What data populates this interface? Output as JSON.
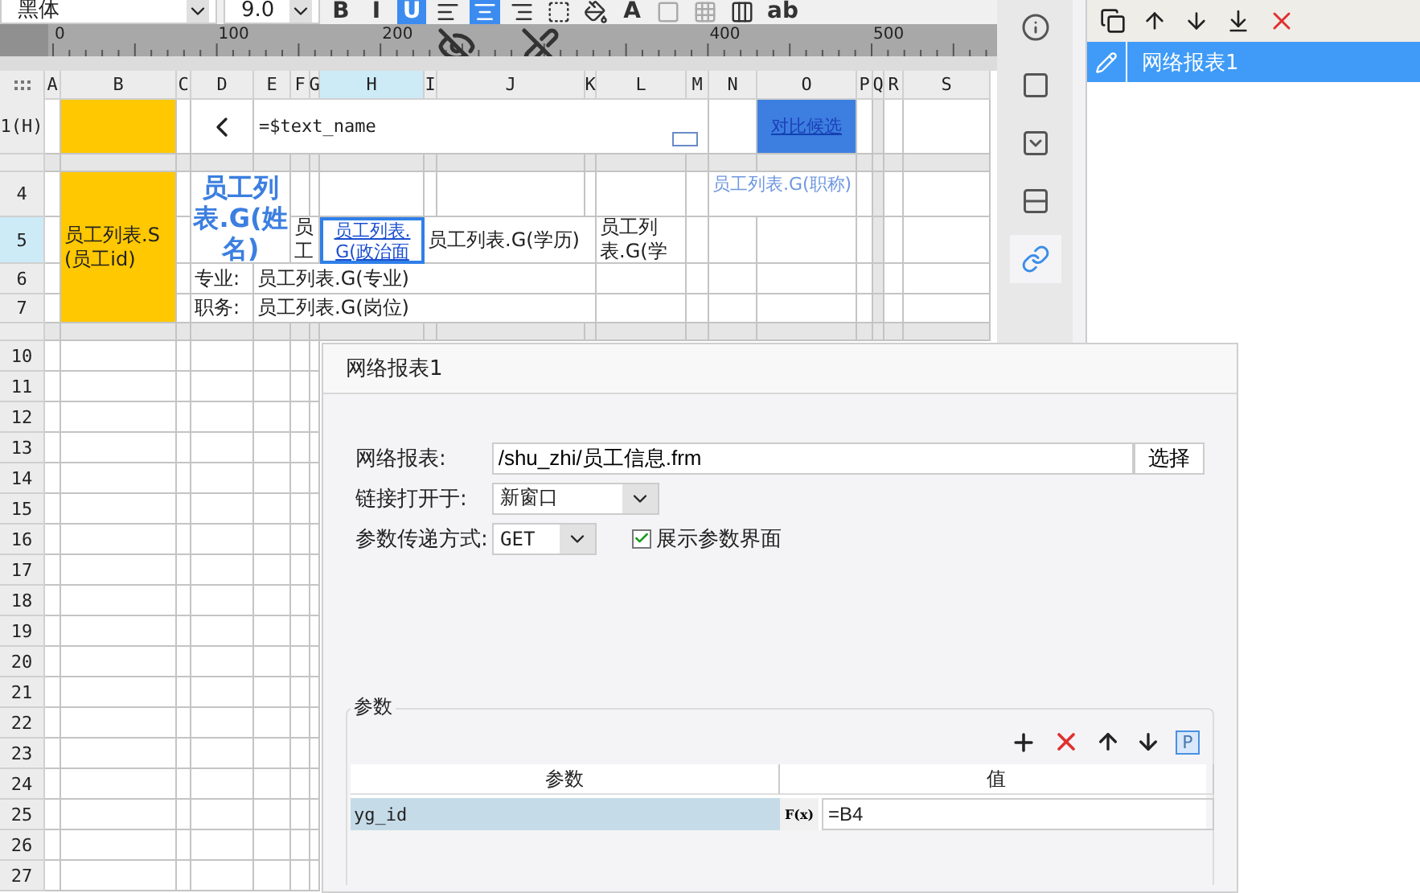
{
  "toolbar": {
    "font": "黑体",
    "size": "9.0",
    "buttons": [
      {
        "kind": "bold",
        "label": "B",
        "selected": false
      },
      {
        "kind": "italic",
        "label": "I",
        "selected": false
      },
      {
        "kind": "underline",
        "label": "U",
        "selected": true
      },
      {
        "kind": "align-left",
        "selected": false
      },
      {
        "kind": "align-center",
        "selected": true
      },
      {
        "kind": "align-right",
        "selected": false
      },
      {
        "kind": "border",
        "selected": false
      },
      {
        "kind": "fill",
        "selected": false
      },
      {
        "kind": "font-color",
        "label": "A",
        "selected": false
      },
      {
        "kind": "cell",
        "selected": false
      },
      {
        "kind": "table",
        "selected": false
      },
      {
        "kind": "insert",
        "selected": false
      },
      {
        "kind": "text",
        "label": "ab",
        "selected": false
      }
    ]
  },
  "ruler": {
    "labels": [
      "0",
      "100",
      "200",
      "400",
      "500"
    ]
  },
  "columns": [
    {
      "label": "A",
      "selected": false
    },
    {
      "label": "B",
      "selected": false
    },
    {
      "label": "C",
      "selected": false
    },
    {
      "label": "D",
      "selected": false
    },
    {
      "label": "E",
      "selected": false
    },
    {
      "label": "F",
      "selected": false
    },
    {
      "label": "G",
      "selected": false
    },
    {
      "label": "H",
      "selected": true
    },
    {
      "label": "I",
      "selected": false
    },
    {
      "label": "J",
      "selected": false
    },
    {
      "label": "K",
      "selected": false
    },
    {
      "label": "L",
      "selected": false
    },
    {
      "label": "M",
      "selected": false
    },
    {
      "label": "N",
      "selected": false
    },
    {
      "label": "O",
      "selected": false
    },
    {
      "label": "P",
      "selected": false
    },
    {
      "label": "Q",
      "selected": false
    },
    {
      "label": "R",
      "selected": false
    },
    {
      "label": "S",
      "selected": false
    }
  ],
  "rows": [
    {
      "label": "1(H)",
      "selected": false
    },
    {
      "label": "4",
      "selected": false
    },
    {
      "label": "5",
      "selected": true
    },
    {
      "label": "6",
      "selected": false
    },
    {
      "label": "7",
      "selected": false
    },
    {
      "label": "10",
      "selected": false
    },
    {
      "label": "11",
      "selected": false
    },
    {
      "label": "12",
      "selected": false
    },
    {
      "label": "13",
      "selected": false
    },
    {
      "label": "14",
      "selected": false
    },
    {
      "label": "15",
      "selected": false
    },
    {
      "label": "16",
      "selected": false
    },
    {
      "label": "17",
      "selected": false
    },
    {
      "label": "18",
      "selected": false
    },
    {
      "label": "19",
      "selected": false
    },
    {
      "label": "20",
      "selected": false
    },
    {
      "label": "21",
      "selected": false
    },
    {
      "label": "22",
      "selected": false
    },
    {
      "label": "23",
      "selected": false
    },
    {
      "label": "24",
      "selected": false
    },
    {
      "label": "25",
      "selected": false
    },
    {
      "label": "26",
      "selected": false
    },
    {
      "label": "27",
      "selected": false
    }
  ],
  "cells": [
    {
      "kind": "fill",
      "color": "#ffc800",
      "selected": false
    },
    {
      "kind": "back",
      "selected": false
    },
    {
      "kind": "formula",
      "text": "=$text_name",
      "selected": false
    },
    {
      "kind": "link",
      "text": "对比候选",
      "color": "#3d7fe0",
      "selected": false
    },
    {
      "kind": "field",
      "text": "员工列表.S(员工id)",
      "color": "#ffc800",
      "selected": false
    },
    {
      "kind": "title",
      "text": "员工列表.G(姓名)",
      "selected": false
    },
    {
      "kind": "field",
      "text": "员工",
      "selected": false
    },
    {
      "kind": "link",
      "text": "员工列表.G(政治面",
      "selected": true
    },
    {
      "kind": "field",
      "text": "员工列表.G(学历)",
      "selected": false
    },
    {
      "kind": "field",
      "text": "员工列表.G(学",
      "selected": false
    },
    {
      "kind": "ghost",
      "text": "员工列表.G(职称)",
      "selected": false
    },
    {
      "kind": "field",
      "text": "专业:",
      "selected": false
    },
    {
      "kind": "field",
      "text": "员工列表.G(专业)",
      "selected": false
    },
    {
      "kind": "field",
      "text": "职务:",
      "selected": false
    },
    {
      "kind": "field",
      "text": "员工列表.G(岗位)",
      "selected": false
    }
  ],
  "side_tabs": [
    {
      "kind": "cell-info",
      "selected": false
    },
    {
      "kind": "border",
      "selected": false
    },
    {
      "kind": "widget",
      "selected": false
    },
    {
      "kind": "layout",
      "selected": false
    },
    {
      "kind": "hyperlink",
      "selected": true
    }
  ],
  "links": [
    {
      "label": "网络报表1",
      "selected": true
    }
  ],
  "dialog": {
    "title": "网络报表1",
    "report_label": "网络报表:",
    "report_value": "/shu_zhi/员工信息.frm",
    "choose_button": "选择",
    "open_label": "链接打开于:",
    "open_value": "新窗口",
    "method_label": "参数传递方式:",
    "method_value": "GET",
    "show_params": {
      "label": "展示参数界面",
      "checked": true
    },
    "params": {
      "legend": "参数",
      "param_button": "P",
      "formula_button": "F(x)",
      "columns": [
        "参数",
        "值"
      ],
      "rows": [
        {
          "name": "yg_id",
          "value": "=B4",
          "selected": true
        }
      ]
    }
  }
}
